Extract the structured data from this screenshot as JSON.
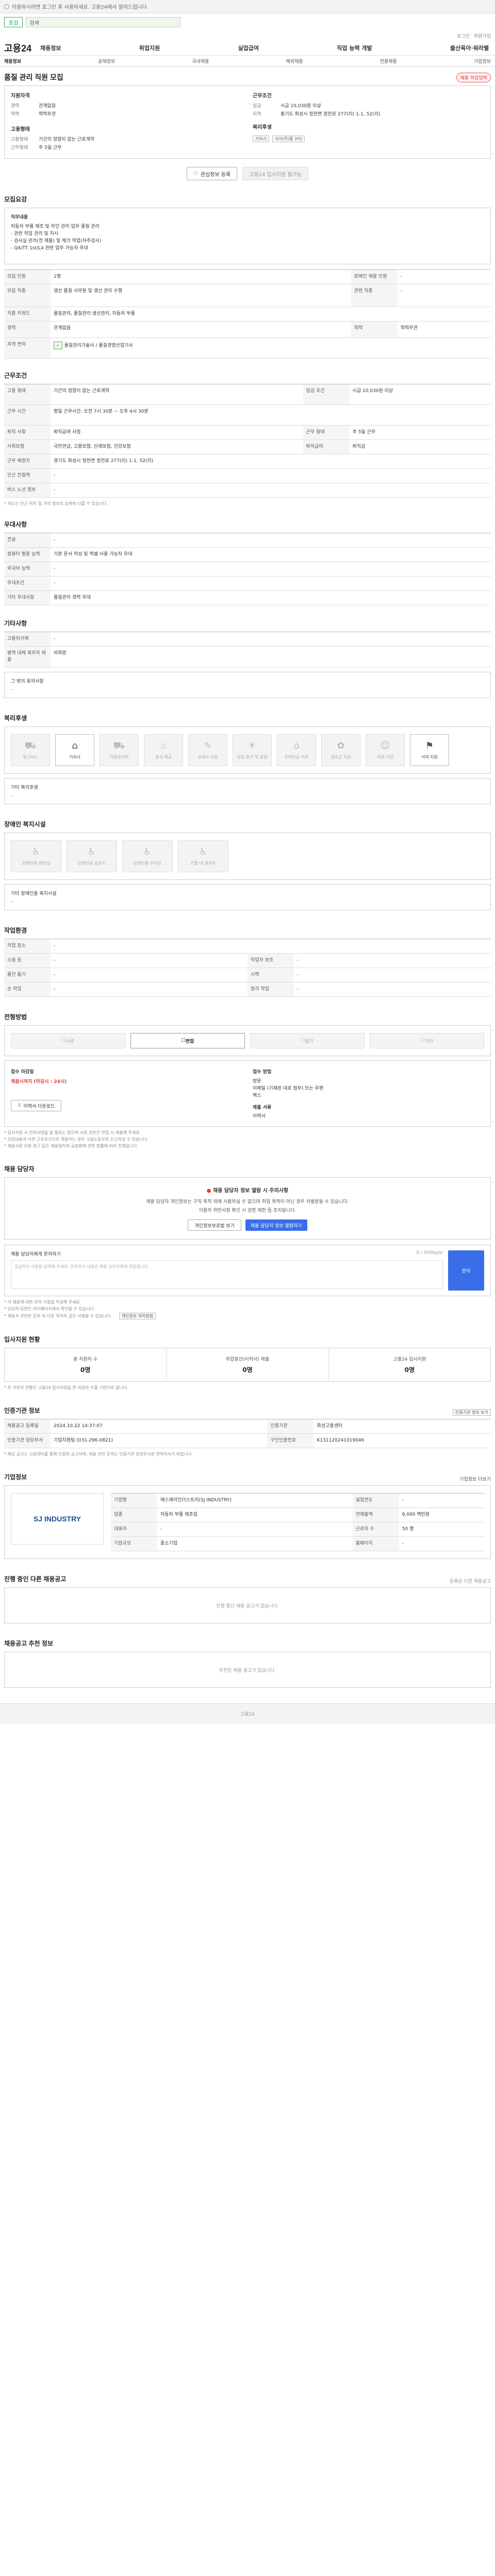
{
  "topbar": {
    "notice": "이용하시려면 로그인 후 사용하세요. 고용24에서 알려드립니다"
  },
  "search": {
    "button": "통합",
    "placeholder": "검색"
  },
  "utils": {
    "login": "로그인",
    "join": "회원가입"
  },
  "brand": {
    "logo": "고용24"
  },
  "gnb": [
    "채용정보",
    "취업지원",
    "실업급여",
    "직업 능력 개발",
    "출산육아·워라밸"
  ],
  "subnav": [
    "채용정보",
    "공채정보",
    "국내채용",
    "해외채용",
    "전용채용",
    "기업정보"
  ],
  "title": {
    "text": "품질 관리 직원 모집",
    "badge": "채용 마감임박"
  },
  "summary": {
    "left_head": "지원자격",
    "left_rows": [
      {
        "k": "경력",
        "v": "관계없음"
      },
      {
        "k": "학력",
        "v": "학력무관"
      }
    ],
    "left_head2": "고용형태",
    "left_rows2": [
      {
        "k": "고용형태",
        "v": "기간의 정함이 없는 근로계약"
      },
      {
        "k": "근무형태",
        "v": "주 5일 근무"
      }
    ],
    "right_head": "근무조건",
    "right_rows": [
      {
        "k": "임금",
        "v": "시급 10,030원 이상"
      },
      {
        "k": "지역",
        "v": "충기도 화성시 정천면 정천로 277(리) 1-1, 52(리)"
      }
    ],
    "right_head2": "복리후생",
    "right_chips": [
      "기숙사",
      "식사(주/중 3식)"
    ]
  },
  "actions": {
    "scrap": "관심정보 등록",
    "apply": "고용24 입사지원 불가능"
  },
  "s1": {
    "title": "모집요강",
    "intro": "직무내용",
    "lines": [
      "자동차 부품 제조 및 라인 관리 업무 품질 관리",
      "- 관련 작업 관리 및 지시",
      "- 검사실 관리(전 제품) 및 체크 작업(자주검사)",
      "- QA/TT 1st/L4 관련 업무 가능자 우대"
    ],
    "rows": [
      {
        "k": "모집 인원",
        "v": "1명",
        "k2": "장애인 채용 인원",
        "v2": "-"
      },
      {
        "k": "모집 직종",
        "v": "생산 품질 사무원 및 생산 관리 수행",
        "k2": "관련 직종",
        "v2": "-"
      },
      {
        "k": "직종 키워드",
        "v": "품질관리, 품질관리 생산관리, 자동차 부품"
      },
      {
        "k": "경력",
        "v": "관계없음",
        "k2": "학력",
        "v2": "학력무관"
      },
      {
        "k": "자격 면허",
        "v": "품질관리기술사 / 품질경영산업기사"
      }
    ]
  },
  "s2": {
    "title": "근무조건",
    "rows": [
      {
        "k": "고용 형태",
        "v": "기간의 정함이 없는 근로계약",
        "k2": "임금 조건",
        "v2": "시급 10,030원 이상"
      },
      {
        "k": "근무 시간",
        "v": "평일 근무시간: 오전 7시 30분 ~ 오후 4시 30분"
      },
      {
        "k": "퇴직 사항",
        "v": "퇴직급여 사정",
        "k2": "근무 형태",
        "v2": "주 5일 근무"
      },
      {
        "k": "사회보험",
        "v": "국민연금, 고용보험, 산재보험, 건강보험",
        "k2": "퇴직급여",
        "v2": "퇴직금"
      },
      {
        "k": "근무 예정지",
        "v": "경기도 화성시 정천면 정천로 277(리) 1-1, 52(리)"
      },
      {
        "k": "인근 전철역",
        "v": "-"
      },
      {
        "k": "버스 노선 정보",
        "v": "-"
      }
    ],
    "note": "* 지도는 인근 위치 및 거리 정보로 실제와 다를 수 있습니다."
  },
  "s3": {
    "title": "우대사항",
    "rows": [
      {
        "k": "전공",
        "v": "-"
      },
      {
        "k": "컴퓨터 활용 능력",
        "v": "기본 문서 작성 및 엑셀 사용 가능자 우대"
      },
      {
        "k": "외국어 능력",
        "v": "-"
      },
      {
        "k": "우대조건",
        "v": "-"
      },
      {
        "k": "기타 우대사항",
        "v": "품질관리 경력 우대"
      }
    ]
  },
  "s4": {
    "title": "기타사항",
    "rows": [
      {
        "k": "고용허가제",
        "v": "-"
      },
      {
        "k": "병역 대체 복무자 채용",
        "v": "비희망"
      }
    ],
    "extra": "그 밖의 유의사항",
    "extra_v": "-"
  },
  "s5": {
    "title": "복리후생",
    "items": [
      {
        "label": "통근버스",
        "glyph": "⛟",
        "on": false
      },
      {
        "label": "기숙사",
        "glyph": "⌂",
        "on": true
      },
      {
        "label": "차량유지비",
        "glyph": "⛟",
        "on": false
      },
      {
        "label": "중식 제공",
        "glyph": "♨",
        "on": false
      },
      {
        "label": "교육비 지원",
        "glyph": "✎",
        "on": false
      },
      {
        "label": "임금 휴가 및 휴일",
        "glyph": "☀",
        "on": false
      },
      {
        "label": "주택자금 지원",
        "glyph": "⌂",
        "on": false
      },
      {
        "label": "경조금 지원",
        "glyph": "✿",
        "on": false
      },
      {
        "label": "직원 지원",
        "glyph": "☺",
        "on": false
      },
      {
        "label": "식대 지원",
        "glyph": "⚑",
        "on": true
      }
    ],
    "other_label": "기타 복리후생",
    "other_v": "-"
  },
  "s6": {
    "title": "장애인 복지시설",
    "items": [
      {
        "label": "장애인용 화장실"
      },
      {
        "label": "장애인용 승강기"
      },
      {
        "label": "장애인용 주차장"
      },
      {
        "label": "건물 내 경사로"
      }
    ],
    "other_label": "기타 장애인용 복지시설",
    "other_v": "-"
  },
  "s7": {
    "title": "작업환경",
    "rows": [
      {
        "k": "작업 장소",
        "v": "-"
      },
      {
        "k": "소음 등",
        "v": "-",
        "k2": "작업자 보조",
        "v2": "-"
      },
      {
        "k": "물건 들기",
        "v": "-",
        "k2": "시력",
        "v2": "-"
      },
      {
        "k": "손 작업",
        "v": "-",
        "k2": "청각 작업",
        "v2": "-"
      }
    ]
  },
  "s8": {
    "title": "전형방법",
    "tabs": [
      {
        "label": "서류",
        "on": false
      },
      {
        "label": "면접",
        "on": true
      },
      {
        "label": "필기",
        "on": false
      },
      {
        "label": "기타",
        "on": false
      }
    ],
    "deadline_label": "접수 마감일",
    "deadline": "채용시까지 (마감시 : 24시)",
    "method_label": "접수 방법",
    "methods": [
      "방문",
      "이메일 (기재된 대로 첨부) 또는 우편",
      "팩스"
    ],
    "doc_label": "제출 서류",
    "doc_v": "이력서",
    "resume_btn": "이력서 다운로드",
    "notes": [
      "* 입사지원 시 전자서명을 할 필요는 없으며 서류 원본은 면접 시 제출해 주세요.",
      "* 모집내용과 다른 근로조건으로 채용하는 경우 고용노동부로 신고하실 수 있습니다.",
      "* 채용서류 반환 청구 등은 채용절차의 공정화에 관한 법률에 따라 진행됩니다."
    ]
  },
  "s9": {
    "title": "채용 담당자",
    "alert_title": "채용 담당자 정보 열람 시 주의사항",
    "alert_text": "채용 담당자 개인정보는 구직 목적 외에 사용하실 수 없으며 취업 목적이 아닌 경우 처벌받을 수 있습니다.",
    "alert_sub": "이용자 위반사항 확인 시 권한 제한 등 조치됩니다.",
    "btn1": "개인정보보호법 보기",
    "btn2": "채용 담당자 정보 열람하기",
    "qa_label": "채용 담당자에게 문의하기",
    "qa_count": "0 / 500byte",
    "qa_placeholder": "궁금하신 사항을 입력해 주세요. 문의하신 내용은 채용 담당자에게 전달됩니다.",
    "qa_btn": "문의",
    "notes": [
      "* 이 채용에 대한 문의 사항을 작성해 주세요.",
      "* 담당자 답변은 마이페이지에서 확인할 수 있습니다.",
      "* 채용과 관련된 문의 외 다른 목적의 글은 삭제될 수 있습니다."
    ],
    "notes_btn": "개인정보 처리방침"
  },
  "s10": {
    "title": "입사지원 현황",
    "stats": [
      {
        "l": "총 지원자 수",
        "n": "0명"
      },
      {
        "l": "취업알선(이력서) 제출",
        "n": "0명"
      },
      {
        "l": "고용24 입사지원",
        "n": "0명"
      }
    ],
    "note": "* 본 지원자 현황은 고용24 입사지원을 한 지원자 수를 기반으로 합니다."
  },
  "s11": {
    "title": "인증기관 정보",
    "link": "인증기관 정보 보기",
    "rows": [
      {
        "k": "채용공고 등록일",
        "v": "2024.10.22 14:37:07",
        "k2": "인증기관",
        "v2": "화성고용센터"
      },
      {
        "k": "인증기관 담당부서",
        "v": "기업지원팀 (031-296-0821)",
        "k2": "구인인증번호",
        "v2": "K131120241019046"
      }
    ],
    "note": "* 해당 공고는 고용센터를 통해 인증된 공고이며, 채용 관련 문의는 인증기관 담당부서로 연락하시기 바랍니다."
  },
  "s12": {
    "title": "기업정보",
    "link": "기업정보 더보기",
    "logo_text": "SJ INDUSTRY",
    "rows": [
      {
        "k": "기업명",
        "v": "에스제이인더스트리(SJ INDUSTRY)",
        "k2": "설립연도",
        "v2": "-"
      },
      {
        "k": "업종",
        "v": "자동차 부품 제조업",
        "k2": "연매출액",
        "v2": "6,000 백만원"
      },
      {
        "k": "대표자",
        "v": "-",
        "k2": "근로자 수",
        "v2": "50 명"
      },
      {
        "k": "기업규모",
        "v": "중소기업",
        "k2": "홈페이지",
        "v2": "-"
      }
    ]
  },
  "s13": {
    "title": "진행 중인 다른 채용공고",
    "sub": "등록된 다른 채용공고",
    "empty": "진행 중인 채용 공고가 없습니다."
  },
  "s14": {
    "title": "채용공고 추천 정보",
    "empty": "추천된 채용 공고가 없습니다."
  },
  "footer": {
    "text": "고용24"
  }
}
